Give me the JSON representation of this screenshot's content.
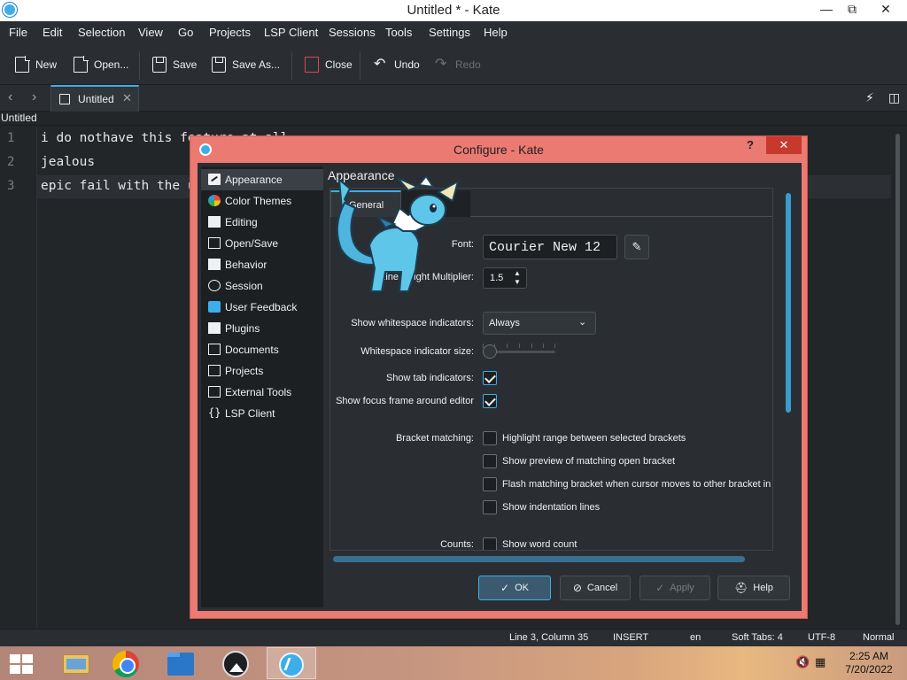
{
  "window": {
    "title": "Untitled * - Kate",
    "minimize": "—",
    "restore": "⧉",
    "close": "✕"
  },
  "menu": [
    "File",
    "Edit",
    "Selection",
    "View",
    "Go",
    "Projects",
    "LSP Client",
    "Sessions",
    "Tools",
    "Settings",
    "Help"
  ],
  "toolbar": {
    "new": "New",
    "open": "Open...",
    "save": "Save",
    "save_as": "Save As...",
    "close": "Close",
    "undo": "Undo",
    "redo": "Redo"
  },
  "tabs": {
    "back": "‹",
    "forward": "›",
    "active_tab": "Untitled",
    "close": "✕"
  },
  "filename": "Untitled",
  "editor": {
    "lines": [
      "i do nothave this feature at all",
      "jealous",
      "epic fail with the update"
    ],
    "line_numbers": [
      "1",
      "2",
      "3"
    ]
  },
  "status": {
    "position": "Line 3, Column 35",
    "mode": "INSERT",
    "language": "en",
    "indent": "Soft Tabs: 4",
    "encoding": "UTF-8",
    "line_ending": "Normal"
  },
  "dialog": {
    "title": "Configure - Kate",
    "help": "?",
    "close": "✕",
    "page_title": "Appearance",
    "tab": "General",
    "sidebar": [
      {
        "label": "Appearance",
        "icon": "appearance-icon",
        "selected": true
      },
      {
        "label": "Color Themes",
        "icon": "color-themes-icon"
      },
      {
        "label": "Editing",
        "icon": "editing-icon"
      },
      {
        "label": "Open/Save",
        "icon": "open-save-icon"
      },
      {
        "label": "Behavior",
        "icon": "behavior-icon"
      },
      {
        "label": "Session",
        "icon": "session-icon"
      },
      {
        "label": "User Feedback",
        "icon": "user-feedback-icon"
      },
      {
        "label": "Plugins",
        "icon": "plugins-icon"
      },
      {
        "label": "Documents",
        "icon": "documents-icon"
      },
      {
        "label": "Projects",
        "icon": "projects-icon"
      },
      {
        "label": "External Tools",
        "icon": "external-tools-icon"
      },
      {
        "label": "LSP Client",
        "icon": "lsp-client-icon"
      }
    ],
    "fields": {
      "font_label": "Font:",
      "font_value": "Courier New 12",
      "line_height_label": "Line Height Multiplier:",
      "line_height_value": "1.5",
      "whitespace_label": "Show whitespace indicators:",
      "whitespace_value": "Always",
      "whitespace_size_label": "Whitespace indicator size:",
      "tab_indicators_label": "Show tab indicators:",
      "focus_frame_label": "Show focus frame around editor",
      "bracket_label": "Bracket matching:",
      "bracket_options": [
        {
          "label": "Highlight range between selected brackets",
          "checked": false
        },
        {
          "label": "Show preview of matching open bracket",
          "checked": false
        },
        {
          "label": "Flash matching bracket when cursor moves to other bracket in p",
          "checked": false
        },
        {
          "label": "Show indentation lines",
          "checked": false
        }
      ],
      "counts_label": "Counts:",
      "word_count_label": "Show word count",
      "tab_indicators_checked": true,
      "focus_frame_checked": true,
      "whitespace_size_level": 0
    },
    "buttons": {
      "ok": "OK",
      "cancel": "Cancel",
      "apply": "Apply",
      "help": "Help"
    }
  },
  "taskbar": {
    "time": "2:25 AM",
    "date": "7/20/2022"
  },
  "colors": {
    "accent": "#3daee9",
    "window_bg": "#232629",
    "dialog_frame": "#eb7a72"
  }
}
